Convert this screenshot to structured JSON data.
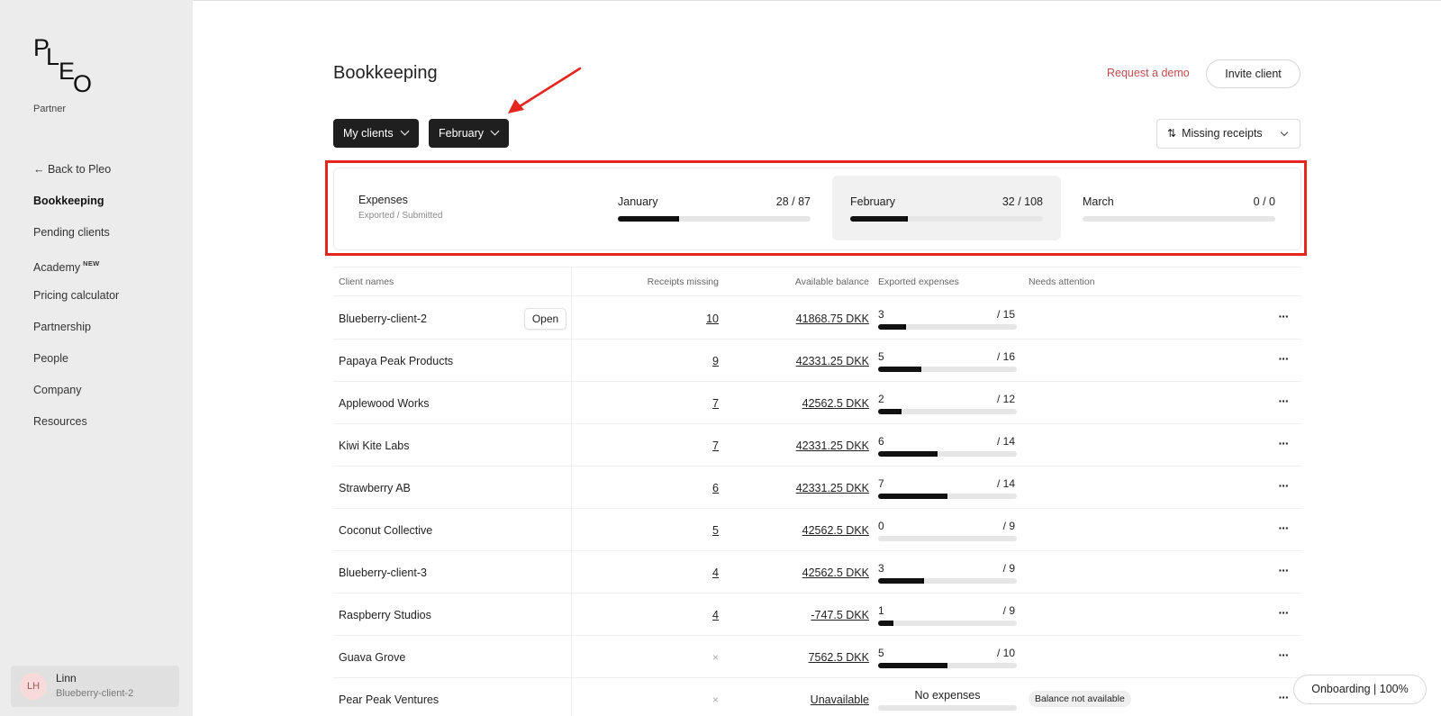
{
  "brand": {
    "logo_letters": [
      "P",
      "L",
      "E",
      "O"
    ],
    "subtitle": "Partner"
  },
  "sidebar": {
    "items": [
      {
        "label": "← Back to Pleo"
      },
      {
        "label": "Bookkeeping",
        "active": true
      },
      {
        "label": "Pending clients"
      },
      {
        "label": "Academy",
        "badge": "NEW"
      },
      {
        "label": "Pricing calculator"
      },
      {
        "label": "Partnership"
      },
      {
        "label": "People"
      },
      {
        "label": "Company"
      },
      {
        "label": "Resources"
      }
    ],
    "user": {
      "initials": "LH",
      "name": "Linn",
      "organization": "Blueberry-client-2"
    }
  },
  "header": {
    "title": "Bookkeeping",
    "request_demo": "Request a demo",
    "invite_client": "Invite client"
  },
  "filters": {
    "clients": "My clients",
    "month": "February",
    "sort": "Missing receipts",
    "sort_icon": "sort-arrows-icon"
  },
  "summary": {
    "title": "Expenses",
    "subtitle": "Exported / Submitted",
    "months": [
      {
        "name": "January",
        "count": "28 / 87",
        "progress": 0.32,
        "selected": false
      },
      {
        "name": "February",
        "count": "32 / 108",
        "progress": 0.3,
        "selected": true
      },
      {
        "name": "March",
        "count": "0 / 0",
        "progress": 0,
        "selected": false
      }
    ]
  },
  "table": {
    "headers": {
      "client_names": "Client names",
      "receipts_missing": "Receipts missing",
      "available_balance": "Available balance",
      "exported_expenses": "Exported expenses",
      "needs_attention": "Needs attention"
    },
    "open_label": "Open",
    "rows": [
      {
        "name": "Blueberry-client-2",
        "missing": "10",
        "balance": "41868.75 DKK",
        "exported": "3",
        "total": "/ 15",
        "progress": 0.2,
        "hovered": true
      },
      {
        "name": "Papaya Peak Products",
        "missing": "9",
        "balance": "42331.25 DKK",
        "exported": "5",
        "total": "/ 16",
        "progress": 0.3125
      },
      {
        "name": "Applewood Works",
        "missing": "7",
        "balance": "42562.5 DKK",
        "exported": "2",
        "total": "/ 12",
        "progress": 0.1667
      },
      {
        "name": "Kiwi Kite Labs",
        "missing": "7",
        "balance": "42331.25 DKK",
        "exported": "6",
        "total": "/ 14",
        "progress": 0.4286
      },
      {
        "name": "Strawberry AB",
        "missing": "6",
        "balance": "42331.25 DKK",
        "exported": "7",
        "total": "/ 14",
        "progress": 0.5
      },
      {
        "name": "Coconut Collective",
        "missing": "5",
        "balance": "42562.5 DKK",
        "exported": "0",
        "total": "/ 9",
        "progress": 0
      },
      {
        "name": "Blueberry-client-3",
        "missing": "4",
        "balance": "42562.5 DKK",
        "exported": "3",
        "total": "/ 9",
        "progress": 0.3333
      },
      {
        "name": "Raspberry Studios",
        "missing": "4",
        "balance": "-747.5 DKK",
        "exported": "1",
        "total": "/ 9",
        "progress": 0.1111
      },
      {
        "name": "Guava Grove",
        "missing": "×",
        "balance": "7562.5 DKK",
        "exported": "5",
        "total": "/ 10",
        "progress": 0.5
      },
      {
        "name": "Pear Peak Ventures",
        "missing": "×",
        "balance": "Unavailable",
        "exported_text": "No expenses",
        "progress": 0,
        "attention": "Balance not available"
      }
    ],
    "more_icon": "more-dots-icon"
  },
  "onboarding": "Onboarding | 100%",
  "colors": {
    "annotation": "#e5261e",
    "accent_link": "#c24e4e",
    "button_dark": "#1f1f1f"
  }
}
